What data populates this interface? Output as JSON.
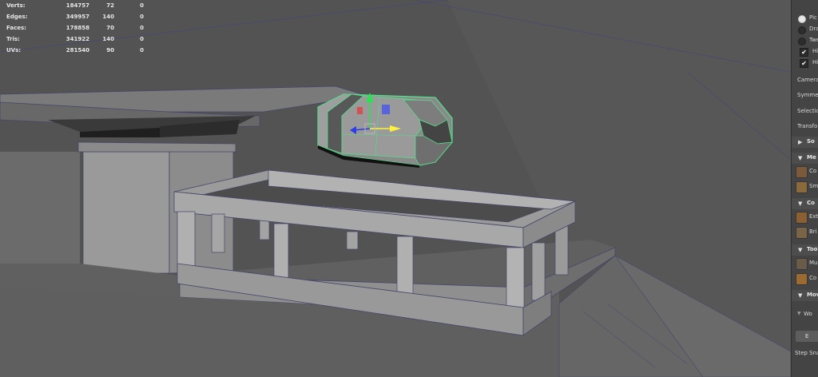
{
  "hud": {
    "rows": [
      {
        "label": "Verts:",
        "v1": "184757",
        "v2": "72",
        "v3": "0"
      },
      {
        "label": "Edges:",
        "v1": "349957",
        "v2": "140",
        "v3": "0"
      },
      {
        "label": "Faces:",
        "v1": "178858",
        "v2": "70",
        "v3": "0"
      },
      {
        "label": "Tris:",
        "v1": "341922",
        "v2": "140",
        "v3": "0"
      },
      {
        "label": "UVs:",
        "v1": "281540",
        "v2": "90",
        "v3": "0"
      }
    ]
  },
  "panel": {
    "radios": [
      {
        "label": "Pic",
        "on": true
      },
      {
        "label": "Dra",
        "on": false
      },
      {
        "label": "Twe",
        "on": false
      }
    ],
    "checks": [
      {
        "label": "Hi",
        "mark": "✔"
      },
      {
        "label": "Hi",
        "mark": "✔"
      }
    ],
    "labels": [
      "Camera",
      "Symme",
      "Selectio",
      "Transfo"
    ],
    "sections": {
      "soft": "So",
      "mesh": "Me",
      "components": "Co",
      "tools": "Too",
      "move": "Mov"
    },
    "tools": {
      "mesh1": "Co",
      "mesh2": "Sm",
      "comp1": "Ext",
      "comp2": "Bri",
      "tool1": "Mu",
      "tool2": "Co"
    },
    "dropdown": "Wo",
    "button": "E",
    "footer": "Step Sna"
  },
  "colors": {
    "viewport_bg": "#535353",
    "selection": "#53e08a",
    "x_axis": "#e23b3b",
    "y_axis": "#2ee052",
    "z_axis": "#2b3ce8",
    "manip_yellow": "#fff23c"
  },
  "icons": {
    "section_triangle": "▼",
    "collapsed_triangle": "▶",
    "dropdown_arrow": "▼"
  }
}
